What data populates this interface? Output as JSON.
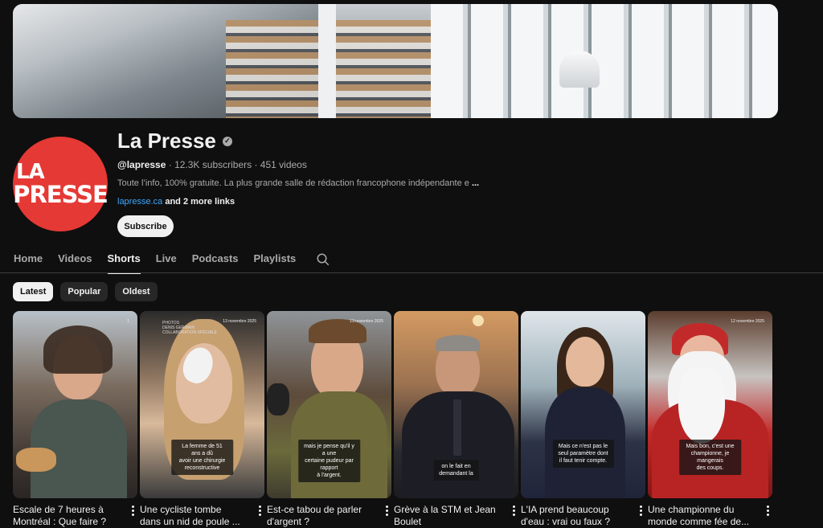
{
  "channel": {
    "name": "La Presse",
    "logo_line1": "LA",
    "logo_line2": "PRESSE",
    "handle": "@lapresse",
    "subscribers": "12.3K subscribers",
    "videos": "451 videos",
    "meta_separator": " · ",
    "description": "Toute l’info, 100% gratuite. La plus grande salle de rédaction francophone indépendante e",
    "description_more": "...more",
    "link": "lapresse.ca",
    "more_links": "and 2 more links",
    "subscribe_label": "Subscribe"
  },
  "tabs": [
    {
      "label": "Home"
    },
    {
      "label": "Videos"
    },
    {
      "label": "Shorts",
      "active": true
    },
    {
      "label": "Live"
    },
    {
      "label": "Podcasts"
    },
    {
      "label": "Playlists"
    }
  ],
  "chips": [
    {
      "label": "Latest",
      "active": true
    },
    {
      "label": "Popular"
    },
    {
      "label": "Oldest"
    }
  ],
  "shorts": [
    {
      "title": "Escale de 7 heures à\nMontréal : Que faire ?",
      "date": "1",
      "caption": ""
    },
    {
      "title": "Une cycliste tombe\ndans un nid de poule ...",
      "date": "13 novembre 2025",
      "credit": "PHOTOS\nDENIS GERMAIN\nCOLLABORATION SPÉCIALE",
      "caption": "La femme de 51 ans a dû\navoir une chirurgie\nreconstructive"
    },
    {
      "title": "Est-ce tabou de parler\nd'argent ?",
      "date": "13 novembre 2025",
      "caption": "mais je pense qu'il y a une\ncertaine pudeur par rapport\nà l'argent."
    },
    {
      "title": "Grève à la STM et Jean\nBoulet",
      "date": "",
      "caption": "on le fait en\ndemandant la"
    },
    {
      "title": "L'IA prend beaucoup\nd'eau : vrai ou faux ?",
      "date": "",
      "caption": "Mais ce n'est pas le\nseul paramètre dont\nil faut tenir compte."
    },
    {
      "title": "Une championne du\nmonde comme fée de...",
      "date": "12 novembre 2025",
      "caption": "Mais bon, c'est une\nchampionne, je mangerais\ndes coups."
    }
  ]
}
